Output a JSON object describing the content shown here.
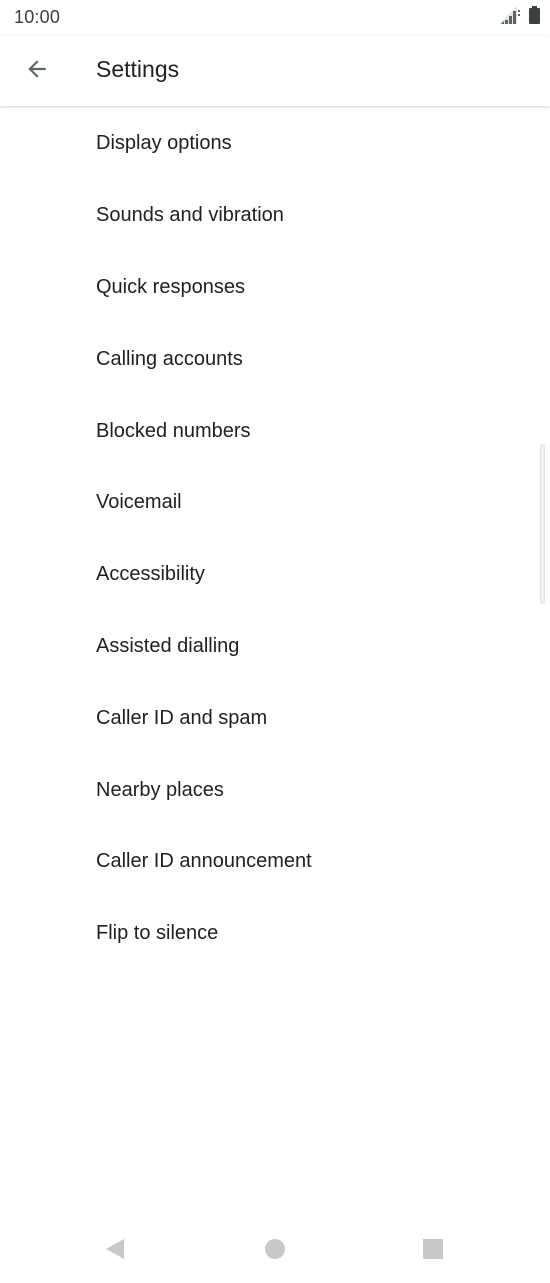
{
  "status_bar": {
    "time": "10:00"
  },
  "app_bar": {
    "title": "Settings",
    "back_icon": "arrow-back-icon"
  },
  "settings": {
    "items": [
      {
        "label": "Display options"
      },
      {
        "label": "Sounds and vibration"
      },
      {
        "label": "Quick responses"
      },
      {
        "label": "Calling accounts"
      },
      {
        "label": "Blocked numbers"
      },
      {
        "label": "Voicemail"
      },
      {
        "label": "Accessibility"
      },
      {
        "label": "Assisted dialling"
      },
      {
        "label": "Caller ID and spam"
      },
      {
        "label": "Nearby places"
      },
      {
        "label": "Caller ID announcement"
      },
      {
        "label": "Flip to silence"
      }
    ]
  },
  "nav_bar": {
    "icons": [
      "nav-back-icon",
      "nav-home-icon",
      "nav-recents-icon"
    ]
  },
  "colors": {
    "text": "#202124",
    "icon": "#5f6368",
    "nav_icon": "#c8c8c8",
    "background": "#ffffff"
  }
}
